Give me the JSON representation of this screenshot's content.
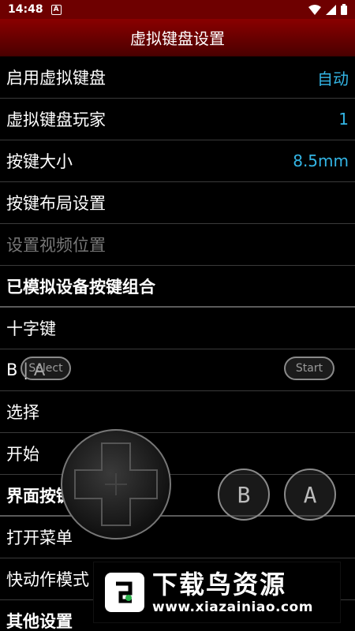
{
  "status_bar": {
    "time": "14:48",
    "notification_glyph": "A"
  },
  "header": {
    "title": "虚拟键盘设置"
  },
  "settings": [
    {
      "label": "启用虚拟键盘",
      "value": "自动"
    },
    {
      "label": "虚拟键盘玩家",
      "value": "1"
    },
    {
      "label": "按键大小",
      "value": "8.5mm"
    },
    {
      "label": "按键布局设置"
    },
    {
      "label": "设置视频位置"
    },
    {
      "label": "已模拟设备按键组合"
    },
    {
      "label": "十字键"
    },
    {
      "label": "B | A"
    },
    {
      "label": "选择"
    },
    {
      "label": "开始"
    },
    {
      "label": "界面按键组合"
    },
    {
      "label": "打开菜单"
    },
    {
      "label": "快动作模式"
    },
    {
      "label": "其他设置"
    }
  ],
  "overlay": {
    "select_label": "Select",
    "start_label": "Start",
    "b_label": "B",
    "a_label": "A"
  },
  "watermark": {
    "title": "下载鸟资源",
    "url": "www.xiazainiao.com"
  },
  "colors": {
    "accent": "#33b5e5",
    "title_bar": "#6e0000"
  }
}
